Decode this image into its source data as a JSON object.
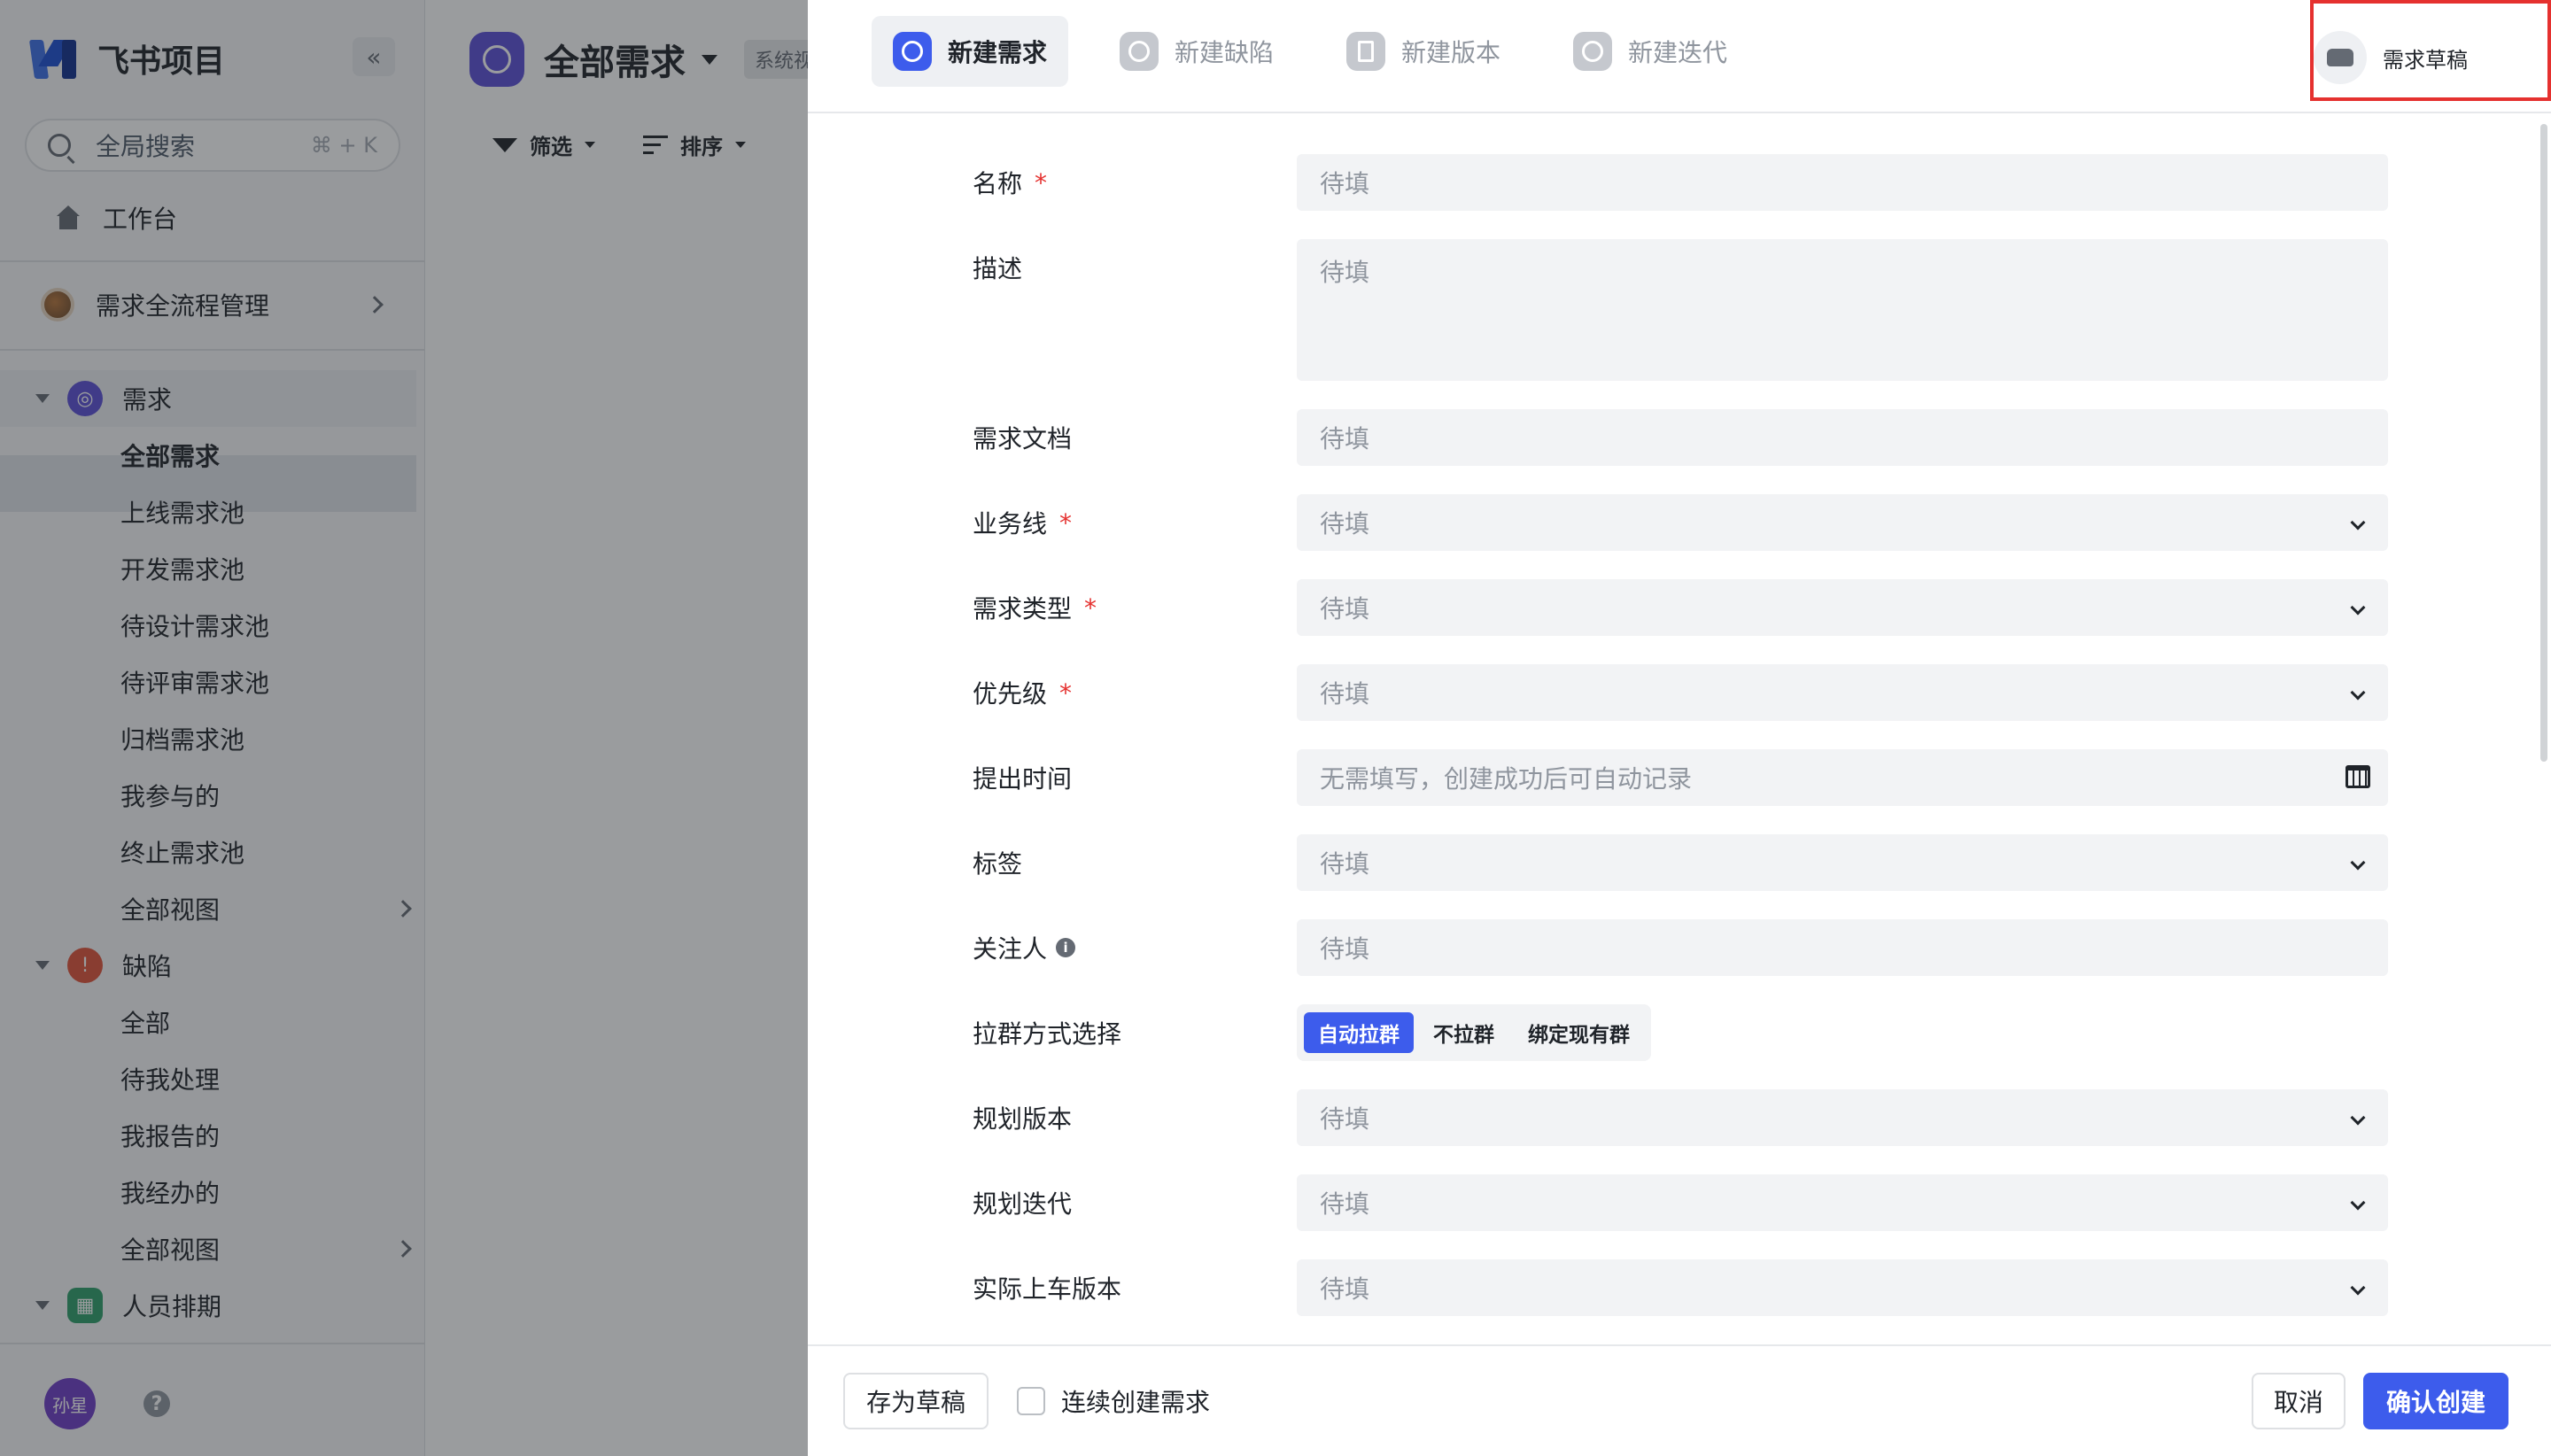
{
  "app": {
    "name": "飞书项目",
    "collapse_icon": "«"
  },
  "search": {
    "placeholder": "全局搜索",
    "shortcut": "⌘ + K"
  },
  "workbench": {
    "label": "工作台"
  },
  "project": {
    "name": "需求全流程管理"
  },
  "sections": {
    "requirement": {
      "label": "需求",
      "color": "#5b4fd8",
      "items": [
        "全部需求",
        "上线需求池",
        "开发需求池",
        "待设计需求池",
        "待评审需求池",
        "归档需求池",
        "我参与的",
        "终止需求池",
        "全部视图"
      ]
    },
    "defect": {
      "label": "缺陷",
      "color": "#e0533a",
      "items": [
        "全部",
        "待我处理",
        "我报告的",
        "我经办的",
        "全部视图"
      ]
    },
    "schedule": {
      "label": "人员排期",
      "color": "#2f9e6a"
    }
  },
  "user": {
    "avatar_text": "孙星",
    "help": "?"
  },
  "main": {
    "title": "全部需求",
    "view_tag": "系统视",
    "filter_label": "筛选",
    "sort_label": "排序"
  },
  "drawer": {
    "tabs": [
      {
        "label": "新建需求",
        "active": true
      },
      {
        "label": "新建缺陷",
        "active": false
      },
      {
        "label": "新建版本",
        "active": false
      },
      {
        "label": "新建迭代",
        "active": false
      }
    ],
    "draft_button": "需求草稿",
    "fields": {
      "name": {
        "label": "名称",
        "placeholder": "待填",
        "required": true
      },
      "description": {
        "label": "描述",
        "placeholder": "待填"
      },
      "doc": {
        "label": "需求文档",
        "placeholder": "待填"
      },
      "business_line": {
        "label": "业务线",
        "placeholder": "待填",
        "required": true
      },
      "req_type": {
        "label": "需求类型",
        "placeholder": "待填",
        "required": true
      },
      "priority": {
        "label": "优先级",
        "placeholder": "待填",
        "required": true
      },
      "submit_time": {
        "label": "提出时间",
        "placeholder": "无需填写，创建成功后可自动记录"
      },
      "tags": {
        "label": "标签",
        "placeholder": "待填"
      },
      "followers": {
        "label": "关注人",
        "placeholder": "待填"
      },
      "group_mode": {
        "label": "拉群方式选择",
        "options": [
          "自动拉群",
          "不拉群",
          "绑定现有群"
        ],
        "selected": "自动拉群"
      },
      "plan_version": {
        "label": "规划版本",
        "placeholder": "待填"
      },
      "plan_iteration": {
        "label": "规划迭代",
        "placeholder": "待填"
      },
      "actual_version": {
        "label": "实际上车版本",
        "placeholder": "待填"
      }
    },
    "required_mark": "*",
    "footer": {
      "save_draft": "存为草稿",
      "continue_create": "连续创建需求",
      "cancel": "取消",
      "confirm": "确认创建"
    }
  }
}
